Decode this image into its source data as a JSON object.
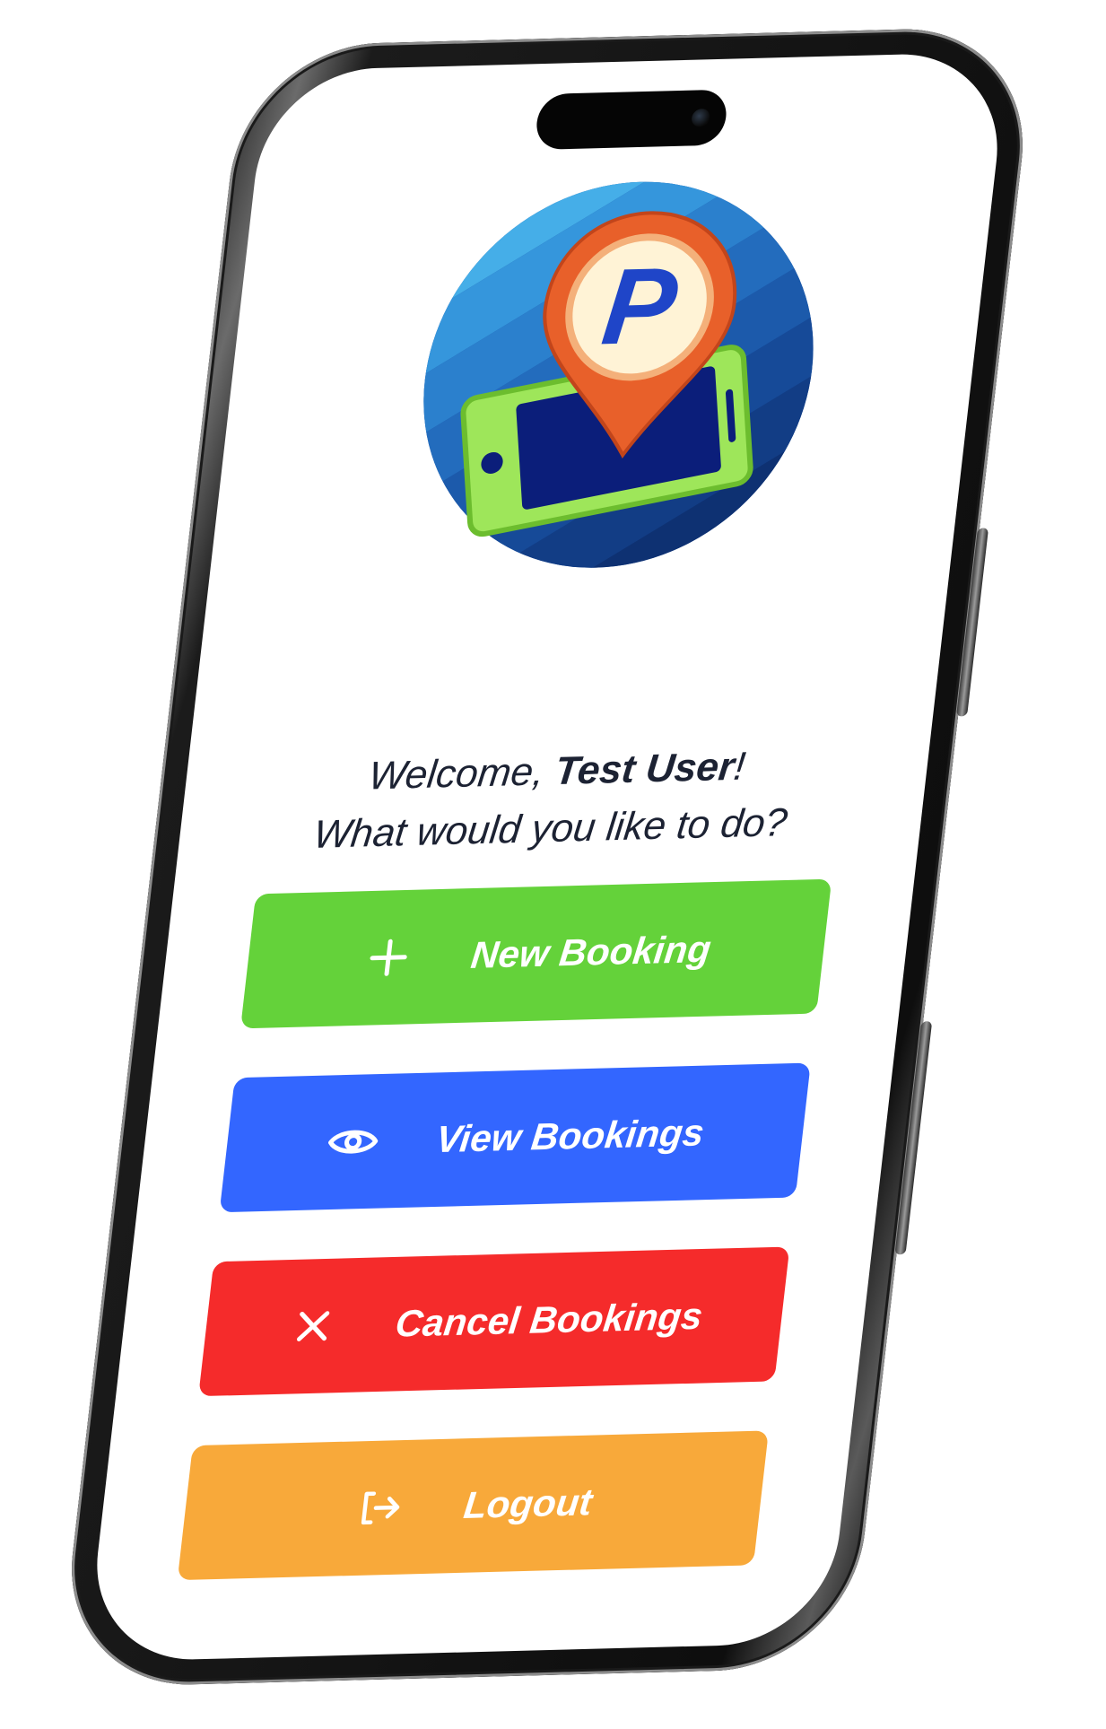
{
  "welcome": {
    "prefix": "Welcome, ",
    "user_name": "Test User",
    "suffix": "!",
    "prompt": "What would you like to do?"
  },
  "actions": [
    {
      "label": "New Booking",
      "icon": "plus-icon",
      "color": "#64d23a"
    },
    {
      "label": "View Bookings",
      "icon": "eye-icon",
      "color": "#3366ff"
    },
    {
      "label": "Cancel Bookings",
      "icon": "close-icon",
      "color": "#f52b2b"
    },
    {
      "label": "Logout",
      "icon": "logout-icon",
      "color": "#f8a93a"
    }
  ],
  "logo": {
    "letter": "P",
    "icon": "parking-location-phone-logo"
  }
}
